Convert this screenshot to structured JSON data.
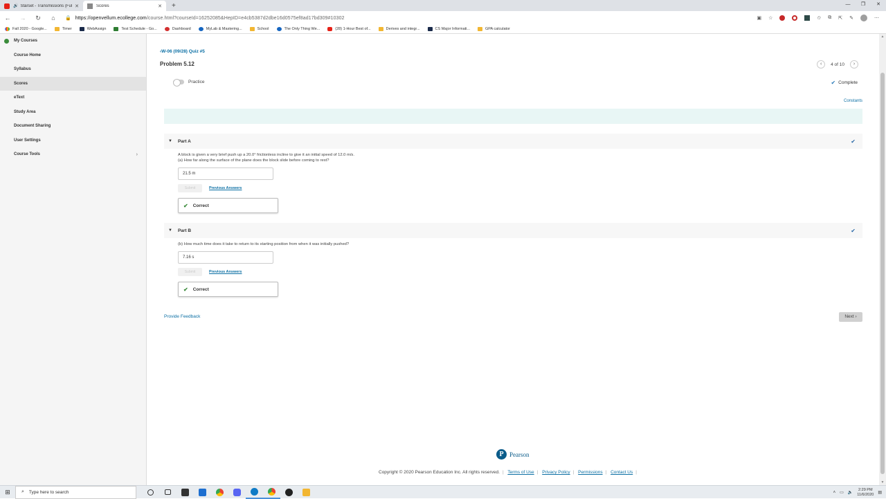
{
  "browser": {
    "tabs": [
      {
        "label": "Starset - Transmissions (Ful",
        "active": false,
        "audio": true
      },
      {
        "label": "Scores",
        "active": true
      }
    ],
    "url_host": "https://openvellum.ecollege.com",
    "url_path": "/course.html?courseId=16252085&HepID=e4cb5387d2dbe16d0575ef8ad17bd309#10302",
    "bookmarks": [
      {
        "label": "Fall 2020 - Google...",
        "icon": "google"
      },
      {
        "label": "Timer",
        "icon": "folder"
      },
      {
        "label": "WebAssign",
        "icon": "dark"
      },
      {
        "label": "Test Schedule - Go...",
        "icon": "green"
      },
      {
        "label": "Dashboard",
        "icon": "red"
      },
      {
        "label": "MyLab & Mastering...",
        "icon": "blue"
      },
      {
        "label": "School",
        "icon": "folder"
      },
      {
        "label": "The Only Thing We...",
        "icon": "blue"
      },
      {
        "label": "(28) 1-Hour Best of...",
        "icon": "youtube"
      },
      {
        "label": "Derives and integr...",
        "icon": "folder"
      },
      {
        "label": "CS Major Informati...",
        "icon": "dark"
      },
      {
        "label": "GPA calculator",
        "icon": "folder"
      }
    ]
  },
  "sidebar": {
    "items": [
      {
        "label": "My Courses",
        "active": false
      },
      {
        "label": "Course Home",
        "active": false
      },
      {
        "label": "Syllabus",
        "active": false
      },
      {
        "label": "Scores",
        "active": true
      },
      {
        "label": "eText",
        "active": false
      },
      {
        "label": "Study Area",
        "active": false
      },
      {
        "label": "Document Sharing",
        "active": false
      },
      {
        "label": "User Settings",
        "active": false
      },
      {
        "label": "Course Tools",
        "active": false
      }
    ]
  },
  "main": {
    "back_link": "W-06 (09/28) Quiz #5",
    "problem_title": "Problem 5.12",
    "pager": "4 of 10",
    "practice_label": "Practice",
    "complete_label": "Complete",
    "constants_label": "Constants",
    "partA": {
      "label": "Part A",
      "question_line1": "A block is given a very brief push up a 20.0° frictionless incline to give it an initial speed of 12.0 m/s.",
      "question_line2": "(a) How far along the surface of the plane does the block slide before coming to rest?",
      "answer": "21.5  m",
      "submit_label": "Submit",
      "previous_label": "Previous Answers",
      "result": "Correct"
    },
    "partB": {
      "label": "Part B",
      "question_line1": "(b) How much time does it take to return to its starting position from when it was initially pushed?",
      "answer": "7.16  s",
      "submit_label": "Submit",
      "previous_label": "Previous Answers",
      "result": "Correct"
    },
    "feedback_label": "Provide Feedback",
    "next_label": "Next"
  },
  "footer": {
    "brand": "Pearson",
    "copyright": "Copyright © 2020 Pearson Education Inc. All rights reserved.",
    "links": [
      "Terms of Use",
      "Privacy Policy",
      "Permissions",
      "Contact Us"
    ]
  },
  "taskbar": {
    "search_placeholder": "Type here to search",
    "time": "2:29 PM",
    "date": "11/6/2020"
  },
  "colors": {
    "accent_link": "#0b6fa4",
    "correct_green": "#3c8c3c",
    "banner": "#e8f6f5"
  }
}
